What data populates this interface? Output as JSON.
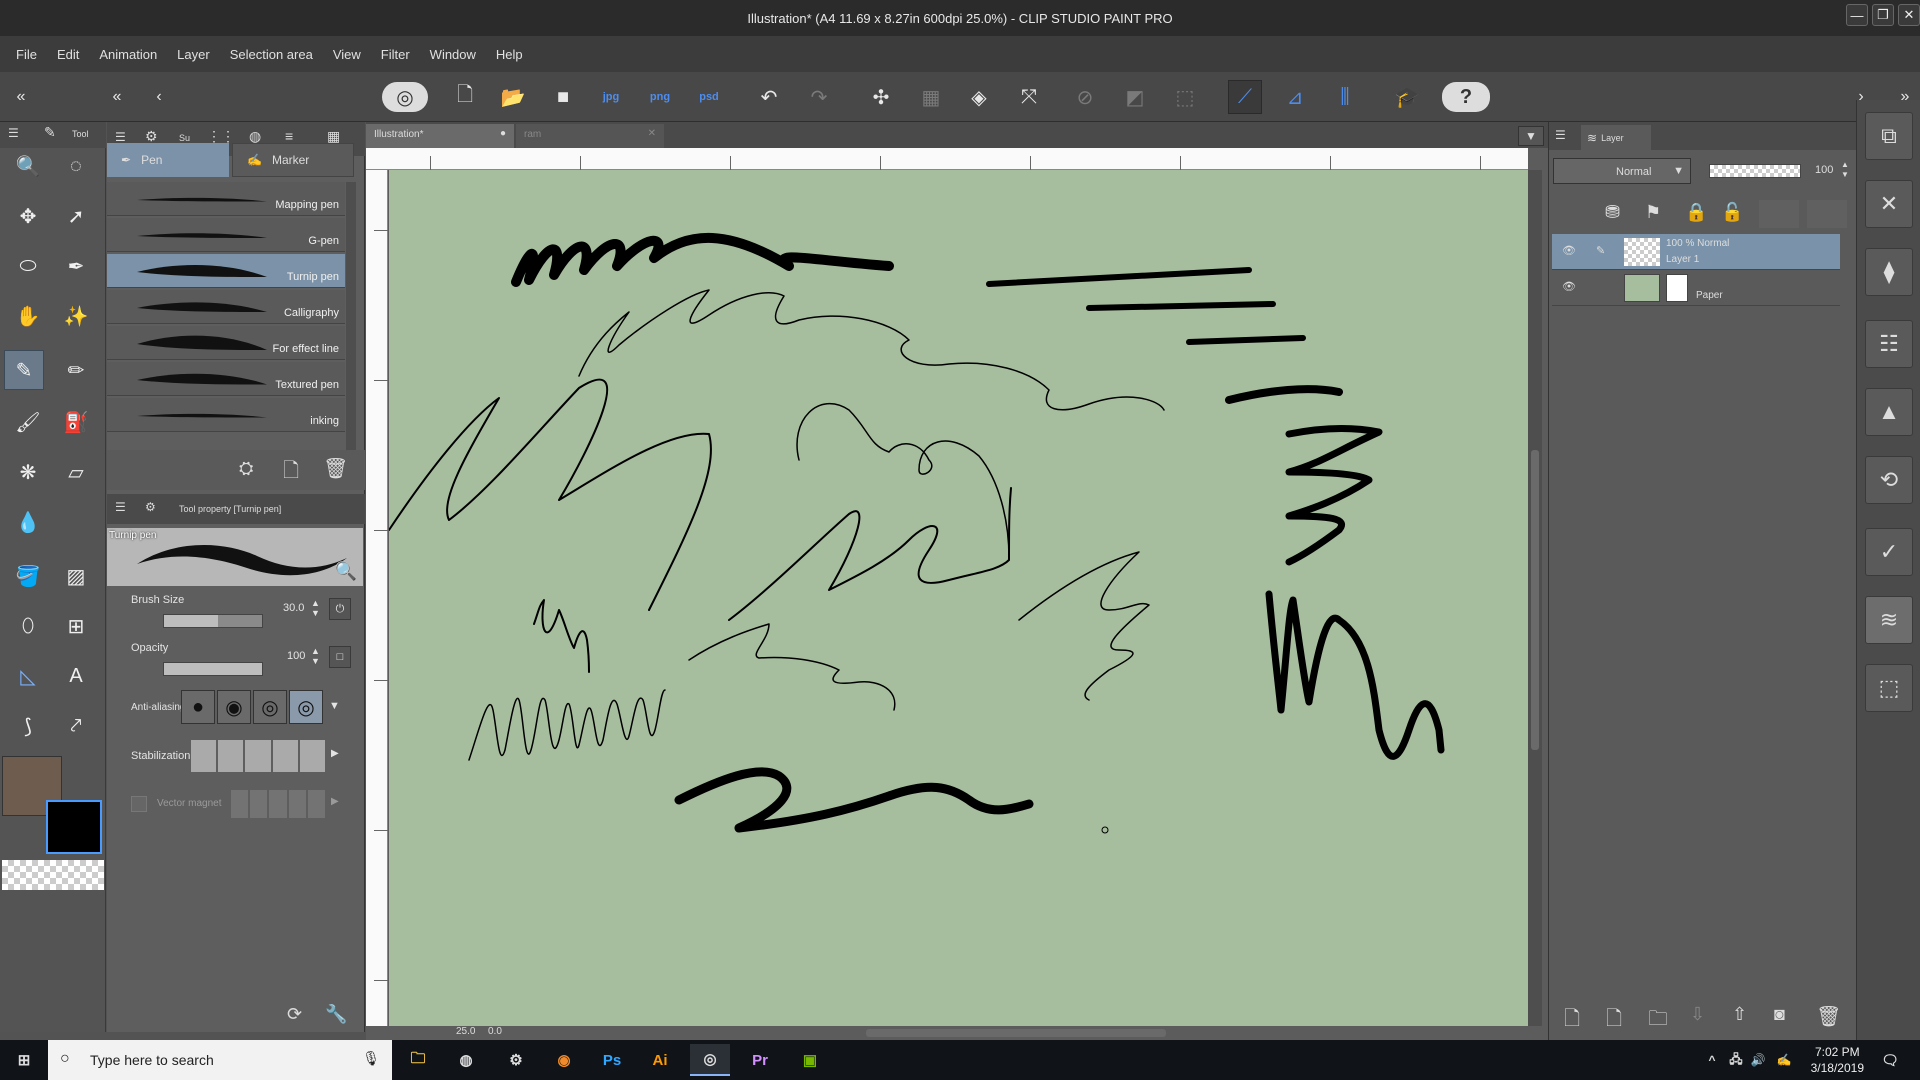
{
  "window": {
    "title": "Illustration* (A4 11.69 x 8.27in 600dpi 25.0%) - CLIP STUDIO PAINT PRO"
  },
  "menu": [
    "File",
    "Edit",
    "Animation",
    "Layer",
    "Selection area",
    "View",
    "Filter",
    "Window",
    "Help"
  ],
  "commands": {
    "jpg": "jpg",
    "png": "png",
    "psd": "psd",
    "help": "?"
  },
  "tool_palette": {
    "tab_label": "Tool",
    "subtab_label": "Su"
  },
  "subtool": {
    "tabs": [
      "Pen",
      "Marker"
    ],
    "brushes": [
      "Mapping pen",
      "G-pen",
      "Turnip pen",
      "Calligraphy",
      "For effect line",
      "Textured pen",
      "inking"
    ],
    "selected": "Turnip pen"
  },
  "tool_property": {
    "header": "Tool property [Turnip pen]",
    "name": "Turnip pen",
    "brush_size_label": "Brush Size",
    "brush_size_value": "30.0",
    "brush_size_fraction": 0.55,
    "opacity_label": "Opacity",
    "opacity_value": "100",
    "opacity_fraction": 1.0,
    "anti_aliasing_label": "Anti-aliasing",
    "stabilization_label": "Stabilization",
    "vector_magnet_label": "Vector magnet"
  },
  "document_tabs": [
    "Illustration*",
    "ram"
  ],
  "status": {
    "zoom": "25.0",
    "angle": "0.0"
  },
  "layer_panel": {
    "tab_label": "Layer",
    "blend_mode": "Normal",
    "opacity_value": "100",
    "layers": [
      {
        "title": "100 % Normal",
        "name": "Layer 1"
      },
      {
        "title": "",
        "name": "Paper"
      }
    ]
  },
  "colors": {
    "main_color": "#6e5d4e",
    "sub_color": "#000000",
    "paper_color": "#a6bd9e"
  },
  "taskbar": {
    "search_placeholder": "Type here to search",
    "apps": [
      "Ps",
      "Ai",
      "Pr"
    ],
    "time": "7:02 PM",
    "date": "3/18/2019"
  }
}
